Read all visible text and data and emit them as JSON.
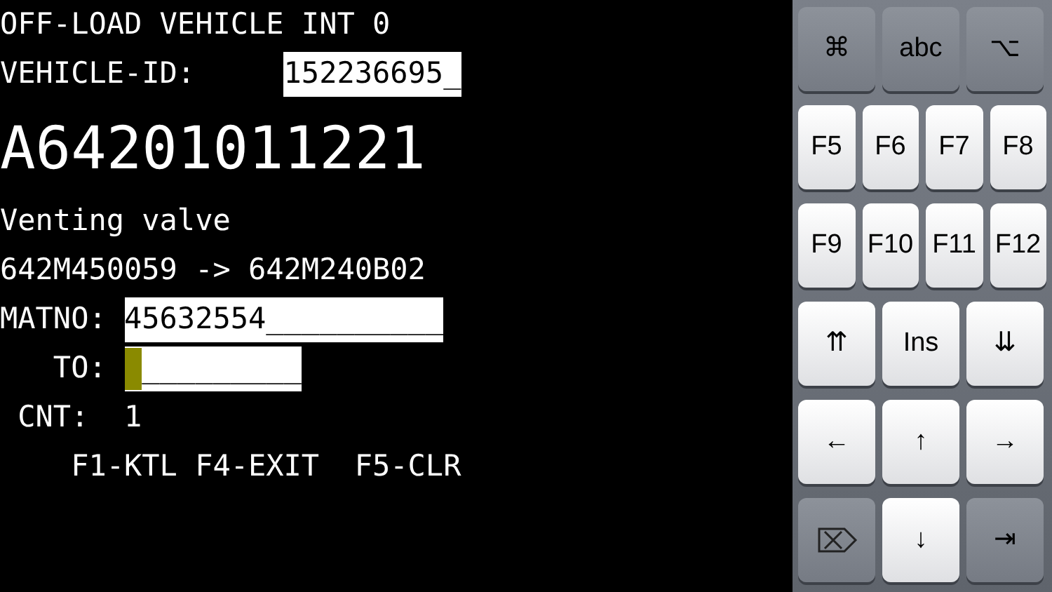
{
  "terminal": {
    "title": "OFF-LOAD VEHICLE INT 0",
    "vehicle_id": {
      "label": "VEHICLE-ID:",
      "value": "152236695_",
      "cursor": false
    },
    "part_number": "A64201011221",
    "description": "Venting valve",
    "mapping": "642M450059 -> 642M240B02",
    "fields": [
      {
        "label": "MATNO:",
        "value": "45632554__________",
        "cursor": false
      },
      {
        "label": "TO:",
        "value": "_________",
        "cursor": true
      }
    ],
    "count": {
      "label": "CNT:",
      "value": "1"
    },
    "function_keys": "F1-KTL F4-EXIT  F5-CLR"
  },
  "keyboard": {
    "rows": [
      [
        {
          "label": "⌘",
          "kind": "dark"
        },
        {
          "label": "abc",
          "kind": "dark"
        },
        {
          "label": "⌥",
          "kind": "dark"
        }
      ],
      [
        {
          "label": "F5",
          "kind": "light"
        },
        {
          "label": "F6",
          "kind": "light"
        },
        {
          "label": "F7",
          "kind": "light"
        },
        {
          "label": "F8",
          "kind": "light"
        }
      ],
      [
        {
          "label": "F9",
          "kind": "light"
        },
        {
          "label": "F10",
          "kind": "light"
        },
        {
          "label": "F11",
          "kind": "light"
        },
        {
          "label": "F12",
          "kind": "light"
        }
      ],
      [
        {
          "label": "⇈",
          "kind": "light"
        },
        {
          "label": "Ins",
          "kind": "light"
        },
        {
          "label": "⇊",
          "kind": "light"
        }
      ],
      [
        {
          "label": "←",
          "kind": "light"
        },
        {
          "label": "↑",
          "kind": "light"
        },
        {
          "label": "→",
          "kind": "light"
        }
      ],
      [
        {
          "kind": "delete"
        },
        {
          "label": "↓",
          "kind": "light"
        },
        {
          "label": "⇥",
          "kind": "dark"
        }
      ]
    ]
  }
}
